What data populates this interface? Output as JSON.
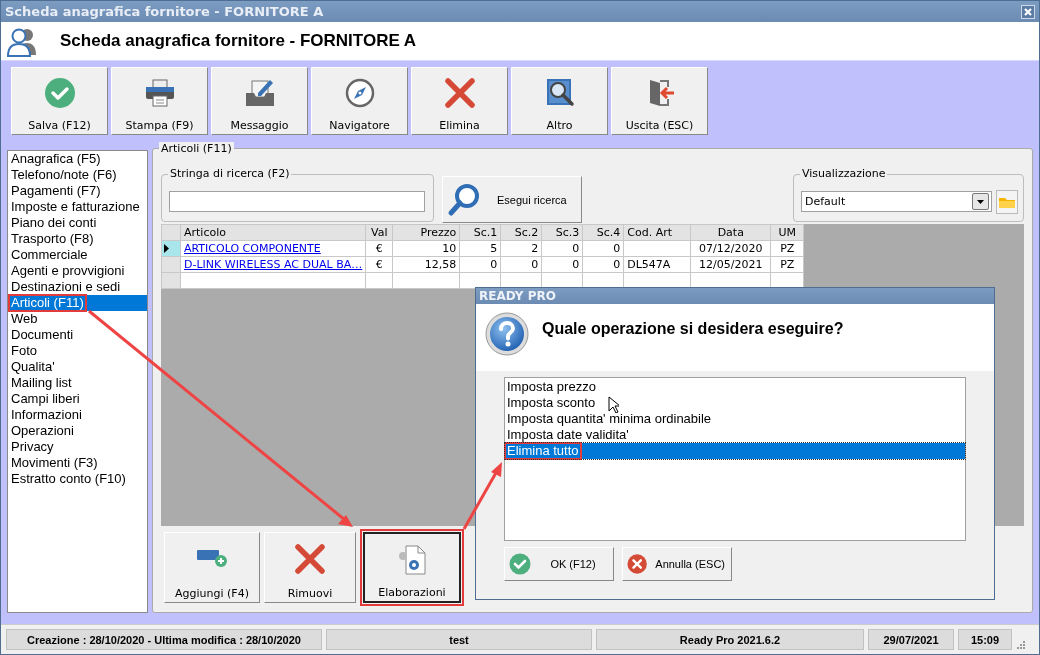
{
  "window": {
    "title": "Scheda anagrafica fornitore - FORNITORE A"
  },
  "header": {
    "title": "Scheda anagrafica fornitore - FORNITORE A"
  },
  "toolbar": [
    {
      "label": "Salva (F12)",
      "kind": "save"
    },
    {
      "label": "Stampa (F9)",
      "kind": "print"
    },
    {
      "label": "Messaggio",
      "kind": "message"
    },
    {
      "label": "Navigatore",
      "kind": "navigator"
    },
    {
      "label": "Elimina",
      "kind": "delete"
    },
    {
      "label": "Altro",
      "kind": "other"
    },
    {
      "label": "Uscita (ESC)",
      "kind": "exit"
    }
  ],
  "sidebar": {
    "items": [
      {
        "label": "Anagrafica (F5)",
        "selected": false,
        "highlighted": false
      },
      {
        "label": "Telefono/note (F6)",
        "selected": false,
        "highlighted": false
      },
      {
        "label": "Pagamenti (F7)",
        "selected": false,
        "highlighted": false
      },
      {
        "label": "Imposte e fatturazione",
        "selected": false,
        "highlighted": false
      },
      {
        "label": "Piano dei conti",
        "selected": false,
        "highlighted": false
      },
      {
        "label": "Trasporto (F8)",
        "selected": false,
        "highlighted": false
      },
      {
        "label": "Commerciale",
        "selected": false,
        "highlighted": false
      },
      {
        "label": "Agenti e provvigioni",
        "selected": false,
        "highlighted": false
      },
      {
        "label": "Destinazioni e sedi",
        "selected": false,
        "highlighted": false
      },
      {
        "label": "Articoli (F11)",
        "selected": true,
        "highlighted": true
      },
      {
        "label": "Web",
        "selected": false,
        "highlighted": false
      },
      {
        "label": "Documenti",
        "selected": false,
        "highlighted": false
      },
      {
        "label": "Foto",
        "selected": false,
        "highlighted": false
      },
      {
        "label": "Qualita'",
        "selected": false,
        "highlighted": false
      },
      {
        "label": "Mailing list",
        "selected": false,
        "highlighted": false
      },
      {
        "label": "Campi liberi",
        "selected": false,
        "highlighted": false
      },
      {
        "label": "Informazioni",
        "selected": false,
        "highlighted": false
      },
      {
        "label": "Operazioni",
        "selected": false,
        "highlighted": false
      },
      {
        "label": "Privacy",
        "selected": false,
        "highlighted": false
      },
      {
        "label": "Movimenti (F3)",
        "selected": false,
        "highlighted": false
      },
      {
        "label": "Estratto conto (F10)",
        "selected": false,
        "highlighted": false
      }
    ]
  },
  "panel": {
    "title": "Articoli (F11)",
    "search": {
      "label": "Stringa di ricerca (F2)"
    },
    "search_button": "Esegui ricerca",
    "view": {
      "label": "Visualizzazione",
      "value": "Default"
    },
    "table": {
      "columns": [
        "Articolo",
        "Val",
        "Prezzo",
        "Sc.1",
        "Sc.2",
        "Sc.3",
        "Sc.4",
        "Cod. Art",
        "Data",
        "UM"
      ],
      "rows": [
        {
          "current": true,
          "cells": [
            "ARTICOLO COMPONENTE",
            "€",
            "10",
            "5",
            "2",
            "0",
            "0",
            "",
            "07/12/2020",
            "PZ"
          ]
        },
        {
          "current": false,
          "cells": [
            "D-LINK WIRELESS AC DUAL BA…",
            "€",
            "12,58",
            "0",
            "0",
            "0",
            "0",
            "DL547A",
            "12/05/2021",
            "PZ"
          ]
        }
      ]
    },
    "actions": [
      {
        "label": "Aggiungi (F4)",
        "kind": "add",
        "highlighted": false
      },
      {
        "label": "Rimuovi",
        "kind": "remove",
        "highlighted": false
      },
      {
        "label": "Elaborazioni",
        "kind": "process",
        "highlighted": true
      }
    ]
  },
  "dialog": {
    "title": "READY PRO",
    "question": "Quale operazione si desidera eseguire?",
    "options": [
      {
        "label": "Imposta prezzo",
        "selected": false,
        "highlighted": false
      },
      {
        "label": "Imposta sconto",
        "selected": false,
        "highlighted": false
      },
      {
        "label": "Imposta quantita' minima ordinabile",
        "selected": false,
        "highlighted": false
      },
      {
        "label": "Imposta date validita'",
        "selected": false,
        "highlighted": false
      },
      {
        "label": "Elimina tutto",
        "selected": true,
        "highlighted": true
      }
    ],
    "buttons": [
      {
        "label": "OK (F12)",
        "kind": "ok"
      },
      {
        "label": "Annulla (ESC)",
        "kind": "cancel"
      }
    ]
  },
  "status_bar": [
    "Creazione : 28/10/2020 - Ultima modifica : 28/10/2020",
    "test",
    "Ready Pro 2021.6.2",
    "29/07/2021",
    "15:09"
  ]
}
